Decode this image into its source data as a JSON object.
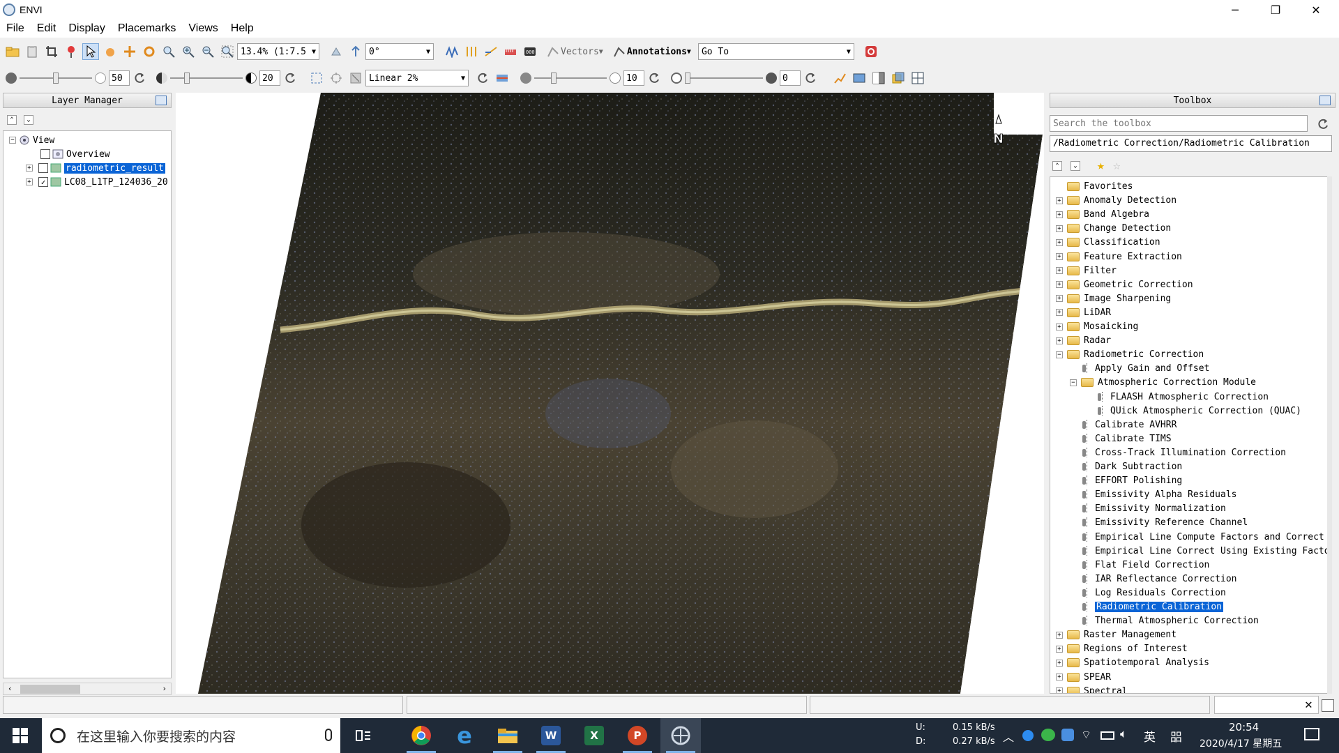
{
  "window": {
    "title": "ENVI",
    "minimize": "─",
    "restore": "❐",
    "close": "✕"
  },
  "menu": [
    "File",
    "Edit",
    "Display",
    "Placemarks",
    "Views",
    "Help"
  ],
  "toolbar1": {
    "zoom_value": "13.4% (1:7.5",
    "rotation_value": "0°",
    "vectors_label": "Vectors",
    "annotations_label": "Annotations",
    "goto_value": "Go To"
  },
  "toolbar2": {
    "brightness_value": "50",
    "contrast_value": "20",
    "stretch_value": "Linear 2%",
    "sharpen_value": "10",
    "transparency_value": "0"
  },
  "layer_manager": {
    "title": "Layer Manager",
    "tree": {
      "root": "View",
      "items": [
        {
          "label": "Overview",
          "checked": false
        },
        {
          "label": "radiometric_result",
          "checked": false,
          "selected": true
        },
        {
          "label": "LC08_L1TP_124036_20",
          "checked": true
        }
      ]
    }
  },
  "toolbox": {
    "title": "Toolbox",
    "search_placeholder": "Search the toolbox",
    "path": "/Radiometric Correction/Radiometric Calibration",
    "folders_top": [
      "Favorites",
      "Anomaly Detection",
      "Band Algebra",
      "Change Detection",
      "Classification",
      "Feature Extraction",
      "Filter",
      "Geometric Correction",
      "Image Sharpening",
      "LiDAR",
      "Mosaicking",
      "Radar"
    ],
    "open_folder": "Radiometric Correction",
    "radiometric_items": [
      {
        "label": "Apply Gain and Offset",
        "level": 1,
        "type": "tool"
      },
      {
        "label": "Atmospheric Correction Module",
        "level": 1,
        "type": "folder"
      },
      {
        "label": "FLAASH Atmospheric Correction",
        "level": 2,
        "type": "tool"
      },
      {
        "label": "QUick Atmospheric Correction (QUAC)",
        "level": 2,
        "type": "tool"
      },
      {
        "label": "Calibrate AVHRR",
        "level": 1,
        "type": "tool"
      },
      {
        "label": "Calibrate TIMS",
        "level": 1,
        "type": "tool"
      },
      {
        "label": "Cross-Track Illumination Correction",
        "level": 1,
        "type": "tool"
      },
      {
        "label": "Dark Subtraction",
        "level": 1,
        "type": "tool"
      },
      {
        "label": "EFFORT Polishing",
        "level": 1,
        "type": "tool"
      },
      {
        "label": "Emissivity Alpha Residuals",
        "level": 1,
        "type": "tool"
      },
      {
        "label": "Emissivity Normalization",
        "level": 1,
        "type": "tool"
      },
      {
        "label": "Emissivity Reference Channel",
        "level": 1,
        "type": "tool"
      },
      {
        "label": "Empirical Line Compute Factors and Correct",
        "level": 1,
        "type": "tool"
      },
      {
        "label": "Empirical Line Correct Using Existing Factor",
        "level": 1,
        "type": "tool"
      },
      {
        "label": "Flat Field Correction",
        "level": 1,
        "type": "tool"
      },
      {
        "label": "IAR Reflectance Correction",
        "level": 1,
        "type": "tool"
      },
      {
        "label": "Log Residuals Correction",
        "level": 1,
        "type": "tool"
      },
      {
        "label": "Radiometric Calibration",
        "level": 1,
        "type": "tool",
        "selected": true
      },
      {
        "label": "Thermal Atmospheric Correction",
        "level": 1,
        "type": "tool"
      }
    ],
    "folders_bottom": [
      "Raster Management",
      "Regions of Interest",
      "Spatiotemporal Analysis",
      "SPEAR",
      "Spectral"
    ]
  },
  "image": {
    "north_label": "N"
  },
  "taskbar": {
    "search_placeholder": "在这里输入你要搜索的内容",
    "net_up_label": "U:",
    "net_down_label": "D:",
    "net_up": "0.15 kB/s",
    "net_down": "0.27 kB/s",
    "ime": "英",
    "ime2": "㗊",
    "time": "20:54",
    "date": "2020/4/17 星期五"
  }
}
